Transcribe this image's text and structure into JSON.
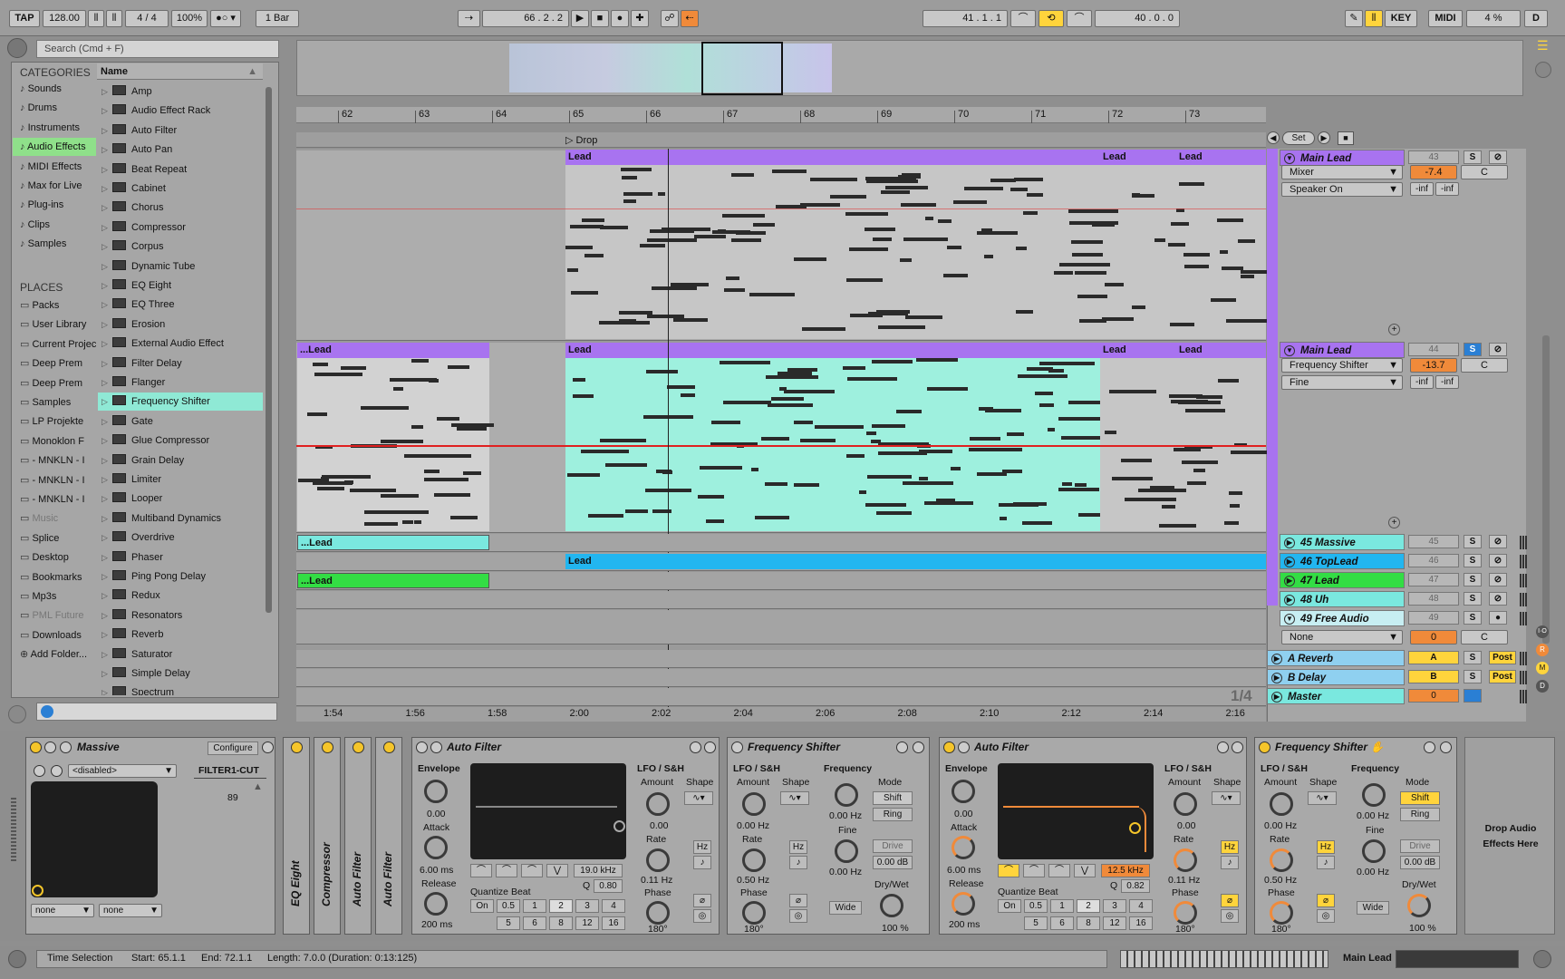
{
  "transport": {
    "tap": "TAP",
    "tempo": "128.00",
    "signature": "4 / 4",
    "zoom": "100%",
    "quantize": "1 Bar",
    "position": "66 .  2 .  2",
    "loop_start": "41 .  1 .  1",
    "loop_length": "40 .  0 .  0",
    "key": "KEY",
    "midi": "MIDI",
    "cpu": "4 %",
    "d": "D"
  },
  "browser": {
    "search_placeholder": "Search (Cmd + F)",
    "categories_header": "CATEGORIES",
    "places_header": "PLACES",
    "name_header": "Name",
    "categories": [
      {
        "label": "Sounds",
        "icon": "note-icon"
      },
      {
        "label": "Drums",
        "icon": "grid-icon"
      },
      {
        "label": "Instruments",
        "icon": "wave-icon"
      },
      {
        "label": "Audio Effects",
        "icon": "audio-effect-icon"
      },
      {
        "label": "MIDI Effects",
        "icon": "midi-effect-icon"
      },
      {
        "label": "Max for Live",
        "icon": "max-icon"
      },
      {
        "label": "Plug-ins",
        "icon": "plugin-icon"
      },
      {
        "label": "Clips",
        "icon": "clip-icon"
      },
      {
        "label": "Samples",
        "icon": "sample-icon"
      }
    ],
    "places": [
      "Packs",
      "User Library",
      "Current Project",
      "Deep Prem",
      "Deep Prem",
      "Samples",
      "LP Projekte",
      "Monoklon F",
      "- MNKLN - I",
      "- MNKLN - I",
      "- MNKLN - I",
      "Music",
      "Splice",
      "Desktop",
      "Bookmarks",
      "Mp3s",
      "PML Future",
      "Downloads",
      "Add Folder..."
    ],
    "items": [
      "Amp",
      "Audio Effect Rack",
      "Auto Filter",
      "Auto Pan",
      "Beat Repeat",
      "Cabinet",
      "Chorus",
      "Compressor",
      "Corpus",
      "Dynamic Tube",
      "EQ Eight",
      "EQ Three",
      "Erosion",
      "External Audio Effect",
      "Filter Delay",
      "Flanger",
      "Frequency Shifter",
      "Gate",
      "Glue Compressor",
      "Grain Delay",
      "Limiter",
      "Looper",
      "Multiband Dynamics",
      "Overdrive",
      "Phaser",
      "Ping Pong Delay",
      "Redux",
      "Resonators",
      "Reverb",
      "Saturator",
      "Simple Delay",
      "Spectrum"
    ],
    "selected_item": "Frequency Shifter"
  },
  "arrangement": {
    "bars": [
      "62",
      "63",
      "64",
      "65",
      "66",
      "67",
      "68",
      "69",
      "70",
      "71",
      "72",
      "73"
    ],
    "locator": "Drop",
    "set_label": "Set",
    "times": [
      "1:54",
      "1:56",
      "1:58",
      "2:00",
      "2:02",
      "2:04",
      "2:06",
      "2:08",
      "2:10",
      "2:12",
      "2:14",
      "2:16"
    ],
    "page": "1/4",
    "clips": {
      "lead": "Lead",
      "lead_cut": "...Lead"
    }
  },
  "tracks": [
    {
      "name": "Main Lead",
      "num": "43",
      "device": "Mixer",
      "param": "Speaker On",
      "vol": "-7.4",
      "pan": "C",
      "inf1": "-inf",
      "inf2": "-inf"
    },
    {
      "name": "Main Lead",
      "num": "44",
      "device": "Frequency Shifter",
      "param": "Fine",
      "vol": "-13.7",
      "pan": "C",
      "inf1": "-inf",
      "inf2": "-inf"
    },
    {
      "name": "45 Massive",
      "num": "45",
      "color": "#7ae8df"
    },
    {
      "name": "46 TopLead",
      "num": "46",
      "color": "#22b6f0"
    },
    {
      "name": "47 Lead",
      "num": "47",
      "color": "#33dd44"
    },
    {
      "name": "48 Uh",
      "num": "48",
      "color": "#7ae8df"
    },
    {
      "name": "49 Free Audio",
      "num": "49",
      "color": "#c7eef2",
      "device": "None",
      "vol": "0",
      "pan": "C"
    },
    {
      "name": "A Reverb",
      "num": "A",
      "color": "#8fd0f0",
      "send": "Post"
    },
    {
      "name": "B Delay",
      "num": "B",
      "color": "#8fd0f0",
      "send": "Post"
    },
    {
      "name": "Master",
      "num": "0",
      "color": "#7ae8df",
      "vol": "0"
    }
  ],
  "devices": {
    "massive": {
      "title": "Massive",
      "configure": "Configure",
      "preset": "<disabled>",
      "param": "FILTER1-CUT",
      "value": "89",
      "none1": "none",
      "none2": "none"
    },
    "vertical": [
      "EQ Eight",
      "Compressor",
      "Auto Filter",
      "Auto Filter"
    ],
    "autofilter1": {
      "title": "Auto Filter",
      "envelope": "Envelope",
      "env_val": "0.00",
      "attack": "Attack",
      "attack_val": "6.00 ms",
      "release": "Release",
      "release_val": "200 ms",
      "freq": "19.0 kHz",
      "q": "0.80",
      "lfo": "LFO / S&H",
      "amount": "Amount",
      "amount_val": "0.00",
      "shape": "Shape",
      "rate": "Rate",
      "rate_val": "0.11 Hz",
      "phase": "Phase",
      "phase_val": "180°",
      "qb": "Quantize Beat",
      "hz": "Hz",
      "qb_buttons": [
        "On",
        "0.5",
        "1",
        "2",
        "3",
        "4"
      ],
      "qb_buttons2": [
        "5",
        "6",
        "8",
        "12",
        "16"
      ]
    },
    "freqshift1": {
      "title": "Frequency Shifter",
      "lfo": "LFO / S&H",
      "amount": "Amount",
      "amount_val": "0.00 Hz",
      "shape": "Shape",
      "rate": "Rate",
      "rate_val": "0.50 Hz",
      "phase": "Phase",
      "phase_val": "180°",
      "hz": "Hz",
      "frequency": "Frequency",
      "freq_val": "0.00 Hz",
      "fine": "Fine",
      "fine_val": "0.00 Hz",
      "mode": "Mode",
      "shift": "Shift",
      "ring": "Ring",
      "drive": "Drive",
      "drive_val": "0.00 dB",
      "wide": "Wide",
      "drywet": "Dry/Wet",
      "drywet_val": "100 %"
    },
    "autofilter2": {
      "title": "Auto Filter",
      "envelope": "Envelope",
      "env_val": "0.00",
      "attack": "Attack",
      "attack_val": "6.00 ms",
      "release": "Release",
      "release_val": "200 ms",
      "freq": "12.5 kHz",
      "q": "0.82",
      "lfo": "LFO / S&H",
      "amount": "Amount",
      "amount_val": "0.00",
      "shape": "Shape",
      "rate": "Rate",
      "rate_val": "0.11 Hz",
      "phase": "Phase",
      "phase_val": "180°",
      "qb": "Quantize Beat",
      "hz": "Hz",
      "qb_buttons": [
        "On",
        "0.5",
        "1",
        "2",
        "3",
        "4"
      ],
      "qb_buttons2": [
        "5",
        "6",
        "8",
        "12",
        "16"
      ]
    },
    "freqshift2": {
      "title": "Frequency Shifter",
      "lfo": "LFO / S&H",
      "amount": "Amount",
      "amount_val": "0.00 Hz",
      "shape": "Shape",
      "rate": "Rate",
      "rate_val": "0.50 Hz",
      "phase": "Phase",
      "phase_val": "180°",
      "hz": "Hz",
      "frequency": "Frequency",
      "freq_val": "0.00 Hz",
      "fine": "Fine",
      "fine_val": "0.00 Hz",
      "mode": "Mode",
      "shift": "Shift",
      "ring": "Ring",
      "drive": "Drive",
      "drive_val": "0.00 dB",
      "wide": "Wide",
      "drywet": "Dry/Wet",
      "drywet_val": "100 %"
    },
    "drop": "Drop Audio Effects Here"
  },
  "status": {
    "selection": "Time Selection",
    "start": "Start: 65.1.1",
    "end": "End: 72.1.1",
    "length": "Length: 7.0.0 (Duration: 0:13:125)",
    "track": "Main Lead"
  },
  "colors": {
    "purple": "#a873f0",
    "aqua": "#7ae8df",
    "blue": "#22b6f0",
    "green": "#33dd44",
    "orange": "#f08a3a",
    "yellow": "#ffd43c"
  }
}
